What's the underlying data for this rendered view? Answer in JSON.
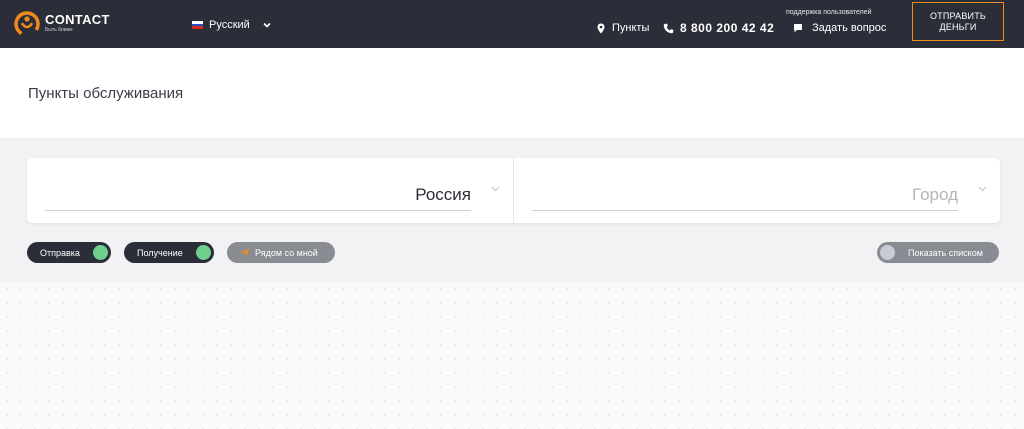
{
  "header": {
    "brand": "CONTACT",
    "tagline": "Быть ближе",
    "language": "Русский",
    "points_label": "Пункты",
    "phone": "8 800 200 42 42",
    "support_caption": "поддержка пользователей",
    "ask_label": "Задать вопрос",
    "send_button": "ОТПРАВИТЬ ДЕНЬГИ",
    "colors": {
      "background": "#2b2e38",
      "accent": "#f08a1c"
    }
  },
  "page": {
    "title": "Пункты обслуживания"
  },
  "search": {
    "country_value": "Россия",
    "city_placeholder": "Город"
  },
  "filters": {
    "send": {
      "label": "Отправка",
      "on": true
    },
    "receive": {
      "label": "Получение",
      "on": true
    },
    "nearby": {
      "label": "Рядом со мной",
      "icon": "navigation-arrow-icon"
    },
    "list_view": {
      "label": "Показать списком",
      "on": false
    },
    "colors": {
      "toggle_on": "#6fcf8c",
      "toggle_off": "#c9ccd4"
    }
  }
}
